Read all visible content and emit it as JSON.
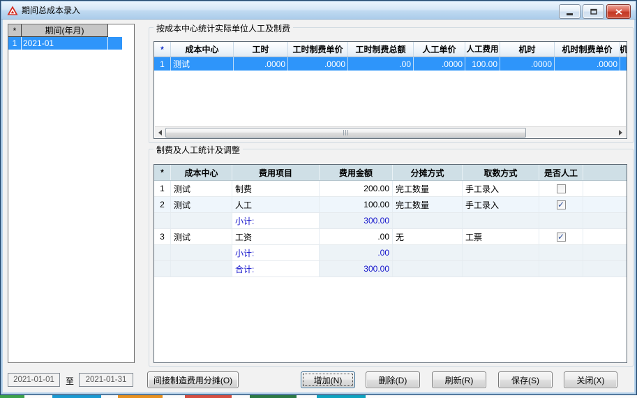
{
  "window": {
    "title": "期间总成本录入"
  },
  "left_list": {
    "col_star": "*",
    "col_period": "期间(年月)",
    "rows": [
      {
        "num": "1",
        "period": "2021-01"
      }
    ]
  },
  "top_section": {
    "title": "按成本中心统计实际单位人工及制费",
    "headers": [
      "*",
      "成本中心",
      "工时",
      "工时制费单价",
      "工时制费总额",
      "人工单价",
      "人工费用",
      "机时",
      "机时制费单价",
      "机"
    ],
    "rows": [
      {
        "num": "1",
        "cost_center": "测试",
        "values": [
          ".0000",
          ".0000",
          ".00",
          ".0000",
          "100.00",
          ".0000",
          ".0000"
        ]
      }
    ]
  },
  "bottom_section": {
    "title": "制费及人工统计及调整",
    "headers": [
      "*",
      "成本中心",
      "费用项目",
      "费用金额",
      "分摊方式",
      "取数方式",
      "是否人工"
    ],
    "rows": [
      {
        "num": "1",
        "cost_center": "测试",
        "item": "制费",
        "amount": "200.00",
        "allocation": "完工数量",
        "source": "手工录入",
        "labor_checked": ""
      },
      {
        "num": "2",
        "cost_center": "测试",
        "item": "人工",
        "amount": "100.00",
        "allocation": "完工数量",
        "source": "手工录入",
        "labor_checked": "✓"
      },
      {
        "label": "小计:",
        "amount": "300.00"
      },
      {
        "num": "3",
        "cost_center": "测试",
        "item": "工资",
        "amount": ".00",
        "allocation": "无",
        "source": "工票",
        "labor_checked": "✓"
      },
      {
        "label": "小计:",
        "amount": ".00"
      },
      {
        "label": "合计:",
        "amount": "300.00"
      }
    ]
  },
  "footer": {
    "date_from": "2021-01-01",
    "separator": "至",
    "date_to": "2021-01-31",
    "allocate_button": "间接制造费用分摊(O)",
    "add_button": "增加(N)",
    "delete_button": "删除(D)",
    "refresh_button": "刷新(R)",
    "save_button": "保存(S)",
    "close_button": "关闭(X)"
  },
  "colors": {
    "selection_blue": "#2e95fa",
    "summary_text_blue": "#1414cc",
    "table_header_teal": "#cfdfe6",
    "titlebar_blue": "#c0daf1",
    "close_button_red": "#c33824"
  }
}
